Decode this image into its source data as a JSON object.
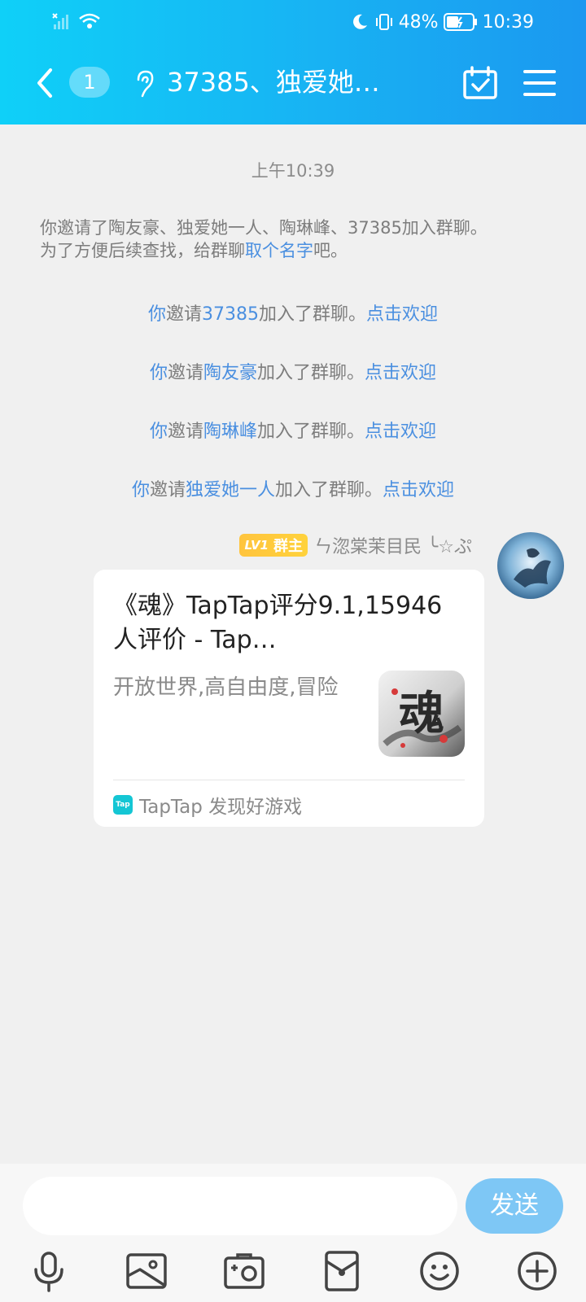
{
  "status_bar": {
    "battery": "48%",
    "time": "10:39"
  },
  "header": {
    "unread_count": "1",
    "title": "37385、独爱她…"
  },
  "messages": {
    "time": "上午10:39",
    "invite_notice": {
      "line1": "你邀请了陶友豪、独爱她一人、陶琳峰、37385加入群聊。",
      "line2_prefix": "为了方便后续查找，给群聊",
      "line2_link": "取个名字",
      "line2_suffix": "吧。"
    },
    "joins": [
      {
        "you": "你",
        "verb": "邀请",
        "name": "37385",
        "text": "加入了群聊。",
        "action": "点击欢迎"
      },
      {
        "you": "你",
        "verb": "邀请",
        "name": "陶友豪",
        "text": "加入了群聊。",
        "action": "点击欢迎"
      },
      {
        "you": "你",
        "verb": "邀请",
        "name": "陶琳峰",
        "text": "加入了群聊。",
        "action": "点击欢迎"
      },
      {
        "you": "你",
        "verb": "邀请",
        "name": "独爱她一人",
        "text": "加入了群聊。",
        "action": "点击欢迎"
      }
    ],
    "sender": {
      "level": "LV1",
      "role": "群主",
      "name": "ㄣ淴棠茉目民 ╰☆ぷ"
    },
    "card": {
      "title": "《魂》TapTap评分9.1,15946 人评价 - Tap…",
      "description": "开放世界,高自由度,冒险",
      "thumb_text": "魂",
      "source_logo": "Tap",
      "source": "TapTap 发现好游戏"
    }
  },
  "input": {
    "placeholder": "",
    "send_label": "发送"
  },
  "colors": {
    "header_start": "#0fd0f8",
    "header_end": "#1b98f0",
    "link": "#4a8fe0",
    "send": "#7ec7f5",
    "badge": "#ffc43d"
  },
  "icons": [
    "back-icon",
    "ear-icon",
    "calendar-icon",
    "menu-icon",
    "microphone-icon",
    "image-icon",
    "camera-icon",
    "red-packet-icon",
    "emoji-icon",
    "plus-icon"
  ]
}
